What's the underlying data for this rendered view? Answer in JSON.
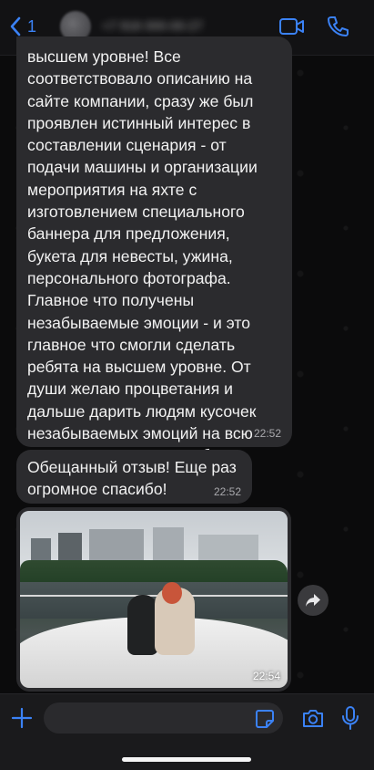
{
  "header": {
    "back_count": "1",
    "contact_name": "+7 916 000-00-27"
  },
  "messages": [
    {
      "text": "высшем уровне! Все соответствовало описанию на сайте компании, сразу же был проявлен истинный интерес в составлении сценария - от подачи машины и организации мероприятия на яхте с изготовлением специального баннера для предложения, букета для невесты, ужина, персонального фотографа. Главное что получены незабываемые эмоции - и это главное что смогли сделать ребята на высшем уровне. От души желаю процветания и дальше дарить людям кусочек незабываемых эмоций на всю жизнь. Огромное спасибо!",
      "time": "22:52"
    },
    {
      "text": "Обещанный отзыв! Еще раз огромное спасибо!",
      "time": "22:52"
    },
    {
      "type": "photo",
      "time": "22:54"
    }
  ],
  "colors": {
    "accent": "#3b82f6",
    "bubble": "#2b2b2e",
    "background": "#0b0b0c"
  },
  "icons": [
    "chevron-left-icon",
    "video-call-icon",
    "phone-icon",
    "forward-icon",
    "plus-icon",
    "sticker-icon",
    "camera-icon",
    "microphone-icon"
  ]
}
